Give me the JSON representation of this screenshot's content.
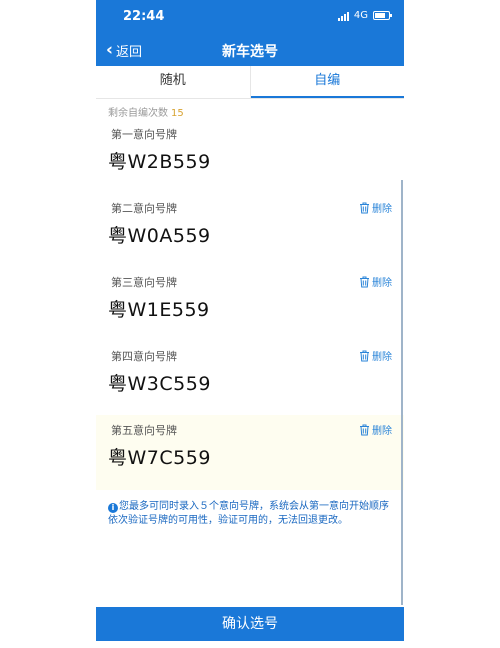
{
  "status_bar": {
    "time": "22:44",
    "network": "4G"
  },
  "nav": {
    "back_label": "返回",
    "title": "新车选号"
  },
  "tabs": [
    {
      "label": "随机",
      "active": false
    },
    {
      "label": "自编",
      "active": true
    }
  ],
  "remaining": {
    "label": "剩余自编次数",
    "count": "15"
  },
  "preferences": [
    {
      "label": "第一意向号牌",
      "plate": "粤W2B559",
      "delete_label": ""
    },
    {
      "label": "第二意向号牌",
      "plate": "粤W0A559",
      "delete_label": "删除"
    },
    {
      "label": "第三意向号牌",
      "plate": "粤W1E559",
      "delete_label": "删除"
    },
    {
      "label": "第四意向号牌",
      "plate": "粤W3C559",
      "delete_label": "删除"
    },
    {
      "label": "第五意向号牌",
      "plate": "粤W7C559",
      "delete_label": "删除"
    }
  ],
  "notice": {
    "text": "您最多可同时录入５个意向号牌，系统会从第一意向开始顺序依次验证号牌的可用性，验证可用的，无法回退更改。"
  },
  "confirm_button": {
    "label": "确认选号"
  },
  "colors": {
    "brand_blue": "#1a78d8",
    "highlight_row": "#fefdf0",
    "count_accent": "#d7a332"
  },
  "icons": {
    "back": "chevron-left-icon",
    "delete": "trash-icon",
    "info": "info-icon"
  }
}
